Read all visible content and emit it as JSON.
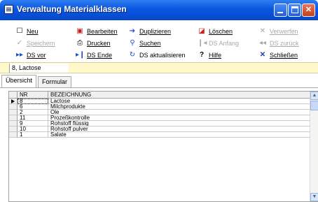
{
  "window": {
    "title": "Verwaltung Materialklassen"
  },
  "toolbar": {
    "neu": "Neu",
    "bearbeiten": "Bearbeiten",
    "duplizieren": "Duplizieren",
    "loeschen": "Löschen",
    "verwerfen": "Verwerfen",
    "speichern": "Speichern",
    "drucken": "Drucken",
    "suchen": "Suchen",
    "ds_anfang": "DS Anfang",
    "ds_zurueck": "DS zurück",
    "ds_vor": "DS vor",
    "ds_ende": "DS Ende",
    "ds_aktualisieren": "DS aktualisieren",
    "hilfe": "Hilfe",
    "schliessen": "Schließen"
  },
  "record": {
    "current": "8, Lactose"
  },
  "tabs": {
    "uebersicht": "Übersicht",
    "formular": "Formular"
  },
  "table": {
    "columns": [
      "NR",
      "BEZEICHNUNG"
    ],
    "rows": [
      {
        "nr": "8",
        "bez": "Lactose"
      },
      {
        "nr": "6",
        "bez": "Milchprodukte"
      },
      {
        "nr": "2",
        "bez": "Öle"
      },
      {
        "nr": "11",
        "bez": "Prozeßkontrolle"
      },
      {
        "nr": "9",
        "bez": "Rohstoff flüssig"
      },
      {
        "nr": "10",
        "bez": "Rohstoff pulver"
      },
      {
        "nr": "1",
        "bez": "Salate"
      }
    ]
  },
  "colors": {
    "titlebar": "#0a56e2",
    "recordbar": "#fff8c8",
    "close": "#c4401c"
  }
}
